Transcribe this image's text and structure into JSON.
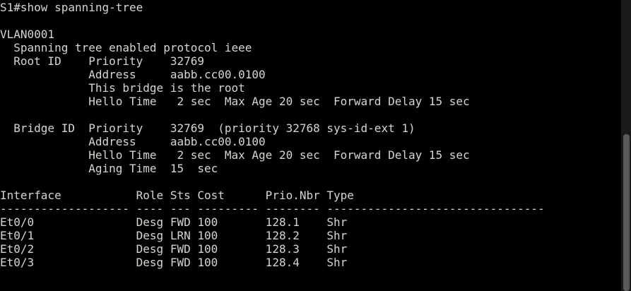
{
  "terminal": {
    "lines": [
      "S1#show spanning-tree",
      "",
      "VLAN0001",
      "  Spanning tree enabled protocol ieee",
      "  Root ID    Priority    32769",
      "             Address     aabb.cc00.0100",
      "             This bridge is the root",
      "             Hello Time   2 sec  Max Age 20 sec  Forward Delay 15 sec",
      "",
      "  Bridge ID  Priority    32769  (priority 32768 sys-id-ext 1)",
      "             Address     aabb.cc00.0100",
      "             Hello Time   2 sec  Max Age 20 sec  Forward Delay 15 sec",
      "             Aging Time  15  sec",
      "",
      "Interface           Role Sts Cost      Prio.Nbr Type",
      "------------------- ---- --- --------- -------- --------------------------------",
      "Et0/0               Desg FWD 100       128.1    Shr",
      "Et0/1               Desg LRN 100       128.2    Shr",
      "Et0/2               Desg FWD 100       128.3    Shr",
      "Et0/3               Desg FWD 100       128.4    Shr",
      ""
    ]
  },
  "colors": {
    "background": "#000000",
    "foreground": "#d3d7cf"
  }
}
